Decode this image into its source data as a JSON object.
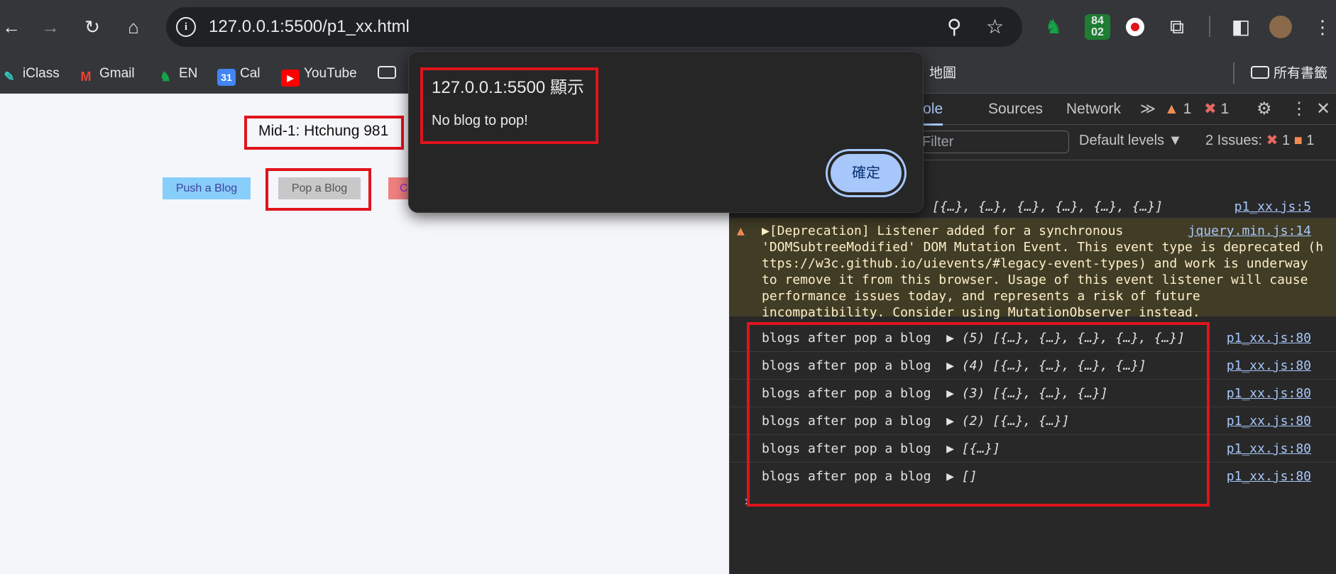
{
  "browser": {
    "url": "127.0.0.1:5500/p1_xx.html",
    "extension_badge": "84\n02",
    "bookmarks": [
      "iClass",
      "Gmail",
      "EN",
      "Cal",
      "YouTube"
    ],
    "bookmark_tail": "地圖",
    "all_bookmarks": "所有書籤",
    "cal_icon": "31",
    "accent": "#a8c7fa"
  },
  "page": {
    "title": "Mid-1: Htchung 981",
    "push_label": "Push a Blog",
    "pop_label": "Pop a Blog",
    "third_label": "C",
    "push_color": "#87cefa",
    "pop_color": "#c8c8c8",
    "third_color": "#f08080"
  },
  "dialog": {
    "origin": "127.0.0.1:5500 顯示",
    "message": "No blog to pop!",
    "ok_label": "確定"
  },
  "devtools": {
    "tabs": [
      "nsole",
      "Sources",
      "Network"
    ],
    "more": "≫",
    "warn_count": "1",
    "err_count": "1",
    "filter_placeholder": "Filter",
    "levels": "Default levels ▼",
    "issues_label": "2 Issues:",
    "issues_err": "1",
    "issues_warn": "1",
    "first_log": {
      "text": "[{…}, {…}, {…}, {…}, {…}, {…}]",
      "source": "p1_xx.js:5"
    },
    "warning": {
      "source": "jquery.min.js:14",
      "lines": [
        "▶[Deprecation] Listener added for a synchronous",
        "'DOMSubtreeModified' DOM Mutation Event. This event type is deprecated (h",
        "ttps://w3c.github.io/uievents/#legacy-event-types) and work is underway",
        "to remove it from this browser. Usage of this event listener will cause",
        "performance issues today, and represents a risk of future",
        "incompatibility. Consider using MutationObserver instead."
      ]
    },
    "logs": [
      {
        "text": "blogs after pop a blog",
        "value": "▶ (5) [{…}, {…}, {…}, {…}, {…}]",
        "source": "p1_xx.js:80"
      },
      {
        "text": "blogs after pop a blog",
        "value": "▶ (4) [{…}, {…}, {…}, {…}]",
        "source": "p1_xx.js:80"
      },
      {
        "text": "blogs after pop a blog",
        "value": "▶ (3) [{…}, {…}, {…}]",
        "source": "p1_xx.js:80"
      },
      {
        "text": "blogs after pop a blog",
        "value": "▶ (2) [{…}, {…}]",
        "source": "p1_xx.js:80"
      },
      {
        "text": "blogs after pop a blog",
        "value": "▶ [{…}]",
        "source": "p1_xx.js:80"
      },
      {
        "text": "blogs after pop a blog",
        "value": "▶ []",
        "source": "p1_xx.js:80"
      }
    ],
    "prompt": "›"
  }
}
